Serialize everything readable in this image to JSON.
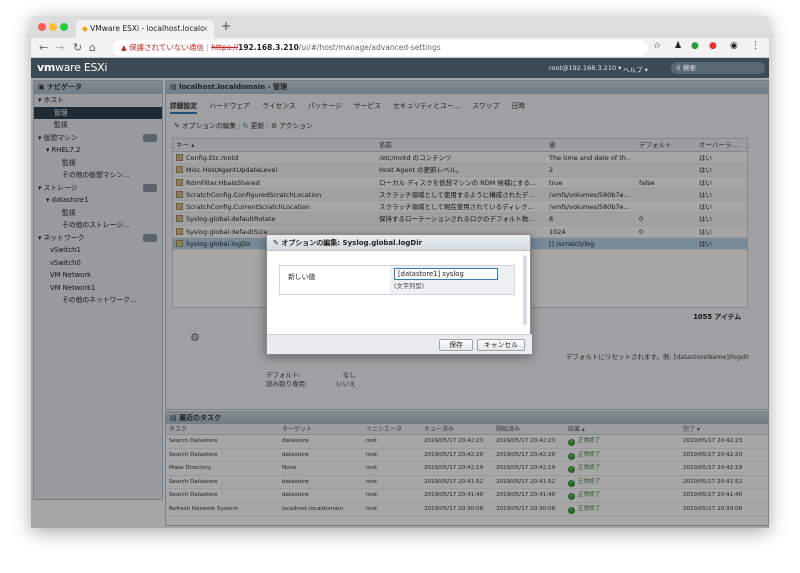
{
  "browser": {
    "tab_title": "VMware ESXi - localhost.localc",
    "url_warning": "保護されていない通信",
    "url_proto": "https://",
    "url_host": "192.168.3.210",
    "url_path": "/ui/#/host/manage/advanced-settings"
  },
  "header": {
    "logo": "vm",
    "logo2": "ware ESXi",
    "user": "root@192.168.3.210 ▾",
    "help": "ヘルプ ▾",
    "search_placeholder": "検索"
  },
  "navigator": {
    "title": "ナビゲータ",
    "items": [
      {
        "label": "▾ ホスト",
        "indent": 4
      },
      {
        "label": "管理",
        "indent": 20,
        "selected": true
      },
      {
        "label": "監視",
        "indent": 20
      },
      {
        "label": "▾ 仮想マシン",
        "indent": 4,
        "badge": true
      },
      {
        "label": "▾ RHEL7.2",
        "indent": 12
      },
      {
        "label": "監視",
        "indent": 28
      },
      {
        "label": "その他の仮想マシン...",
        "indent": 28
      },
      {
        "label": "▾ ストレージ",
        "indent": 4,
        "badge": true
      },
      {
        "label": "▾ datastore1",
        "indent": 12
      },
      {
        "label": "監視",
        "indent": 28
      },
      {
        "label": "その他のストレージ...",
        "indent": 28
      },
      {
        "label": "▾ ネットワーク",
        "indent": 4,
        "badge": true
      },
      {
        "label": "vSwitch1",
        "indent": 16
      },
      {
        "label": "vSwitch0",
        "indent": 16
      },
      {
        "label": "VM Network",
        "indent": 16
      },
      {
        "label": "VM Network1",
        "indent": 16
      },
      {
        "label": "その他のネットワーク...",
        "indent": 28
      }
    ]
  },
  "main": {
    "title": "localhost.localdomain - 管理",
    "tabs": [
      "詳細設定",
      "ハードウェア",
      "ライセンス",
      "パッケージ",
      "サービス",
      "セキュリティとユー...",
      "スワップ",
      "日時"
    ],
    "toolbar": {
      "edit": "オプションの編集",
      "refresh": "更新",
      "actions": "アクション"
    },
    "columns": [
      "キー ▴",
      "名前",
      "値",
      "デフォルト",
      "オーバーラ..."
    ],
    "rows": [
      [
        "Config.Etc.motd",
        "/etc/motd のコンテンツ",
        "The time and date of th...",
        "",
        "はい"
      ],
      [
        "Misc.HostAgentUpdateLevel",
        "Host Agent の更新レベル。",
        "2",
        "",
        "はい"
      ],
      [
        "RdmFilter.HbaIsShared",
        "ローカル ディスクを仮想マシンの RDM 候補にする...",
        "true",
        "false",
        "はい"
      ],
      [
        "ScratchConfig.ConfiguredScratchLocation",
        "スクラッチ領域として使用するように構成されたデ...",
        "/vmfs/volumes/580b7e...",
        "",
        "はい"
      ],
      [
        "ScratchConfig.CurrentScratchLocation",
        "スクラッチ領域として現在使用されているディレク...",
        "/vmfs/volumes/580b7e...",
        "",
        "はい"
      ],
      [
        "Syslog.global.defaultRotate",
        "保持するローテーションされるログのデフォルト数...",
        "8",
        "0",
        "はい"
      ],
      [
        "Syslog.global.defaultSize",
        "",
        "1024",
        "0",
        "はい"
      ],
      [
        "Syslog.global.logDir",
        "",
        "[] /scratch/log",
        "",
        "はい"
      ]
    ],
    "count": "1055 アイテム",
    "detail1": "デフォルト:",
    "detail1v": "なし",
    "detail2": "読み取り専用:",
    "detail2v": "いいえ",
    "reset_note": "デフォルトにリセットされます。例: [datastoreName]/logdir"
  },
  "tasks": {
    "title": "最近のタスク",
    "columns": [
      "タスク",
      "ターゲット",
      "イニシエータ",
      "キュー済み",
      "開始済み",
      "結果 ▴",
      "完了 ▾"
    ],
    "rows": [
      [
        "Search Datastore",
        "datastore",
        "root",
        "2019/05/17 20:42:23",
        "2019/05/17 20:42:23",
        "正常終了",
        "2019/05/17 20:42:23"
      ],
      [
        "Search Datastore",
        "datastore",
        "root",
        "2019/05/17 20:42:20",
        "2019/05/17 20:42:20",
        "正常終了",
        "2019/05/17 20:42:20"
      ],
      [
        "Make Directory",
        "None",
        "root",
        "2019/05/17 20:42:19",
        "2019/05/17 20:42:19",
        "正常終了",
        "2019/05/17 20:42:19"
      ],
      [
        "Search Datastore",
        "datastore",
        "root",
        "2019/05/17 20:41:52",
        "2019/05/17 20:41:52",
        "正常終了",
        "2019/05/17 20:41:52"
      ],
      [
        "Search Datastore",
        "datastore",
        "root",
        "2019/05/17 20:41:40",
        "2019/05/17 20:41:40",
        "正常終了",
        "2019/05/17 20:41:40"
      ],
      [
        "Refresh Network System",
        "localhost.localdomain",
        "root",
        "2019/05/17 20:30:08",
        "2019/05/17 20:30:08",
        "正常終了",
        "2019/05/17 20:30:08"
      ]
    ]
  },
  "dialog": {
    "title": "オプションの編集: Syslog.global.logDir",
    "label": "新しい値",
    "value": "[datastore1] syslog",
    "type": "(文字列型)",
    "save": "保存",
    "cancel": "キャンセル"
  }
}
